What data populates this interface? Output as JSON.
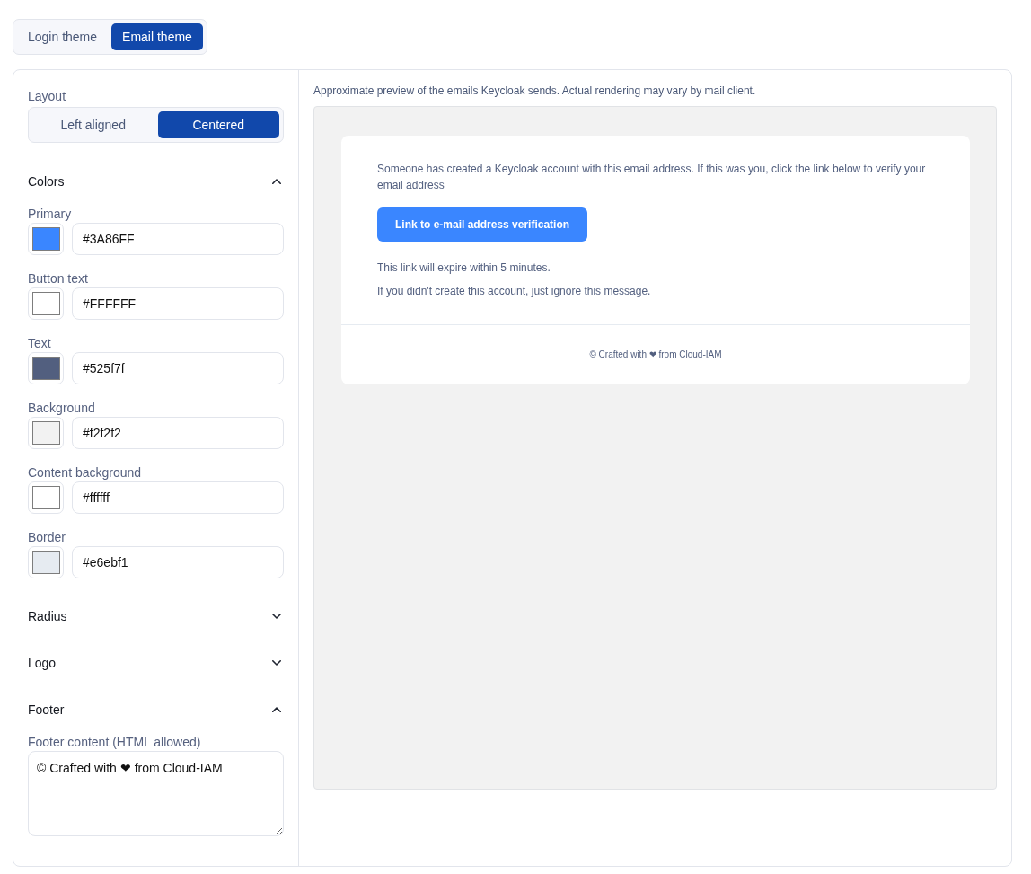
{
  "theme_tabs": [
    {
      "label": "Login theme",
      "selected": false
    },
    {
      "label": "Email theme",
      "selected": true
    }
  ],
  "settings": {
    "layout": {
      "label": "Layout",
      "options": [
        {
          "label": "Left aligned",
          "selected": false
        },
        {
          "label": "Centered",
          "selected": true
        }
      ]
    },
    "sections": [
      {
        "title": "Colors",
        "expanded": true,
        "fields": [
          {
            "label": "Primary",
            "value": "#3A86FF",
            "color": "#3a86ff"
          },
          {
            "label": "Button text",
            "value": "#FFFFFF",
            "color": "#ffffff"
          },
          {
            "label": "Text",
            "value": "#525f7f",
            "color": "#525f7f"
          },
          {
            "label": "Background",
            "value": "#f2f2f2",
            "color": "#f2f2f2"
          },
          {
            "label": "Content background",
            "value": "#ffffff",
            "color": "#ffffff"
          },
          {
            "label": "Border",
            "value": "#e6ebf1",
            "color": "#e6ebf1"
          }
        ]
      },
      {
        "title": "Radius",
        "expanded": false
      },
      {
        "title": "Logo",
        "expanded": false
      },
      {
        "title": "Footer",
        "expanded": true,
        "textarea": {
          "label": "Footer content (HTML allowed)",
          "value": "© Crafted with ❤ from Cloud-IAM"
        }
      }
    ]
  },
  "preview": {
    "caption": "Approximate preview of the emails Keycloak sends. Actual rendering may vary by mail client.",
    "email": {
      "message": "Someone has created a Keycloak account with this email address. If this was you, click the link below to verify your email address",
      "button": "Link to e-mail address verification",
      "notes": [
        "This link will expire within 5 minutes.",
        "If you didn't create this account, just ignore this message."
      ],
      "footer": "© Crafted with ❤ from Cloud-IAM"
    }
  }
}
